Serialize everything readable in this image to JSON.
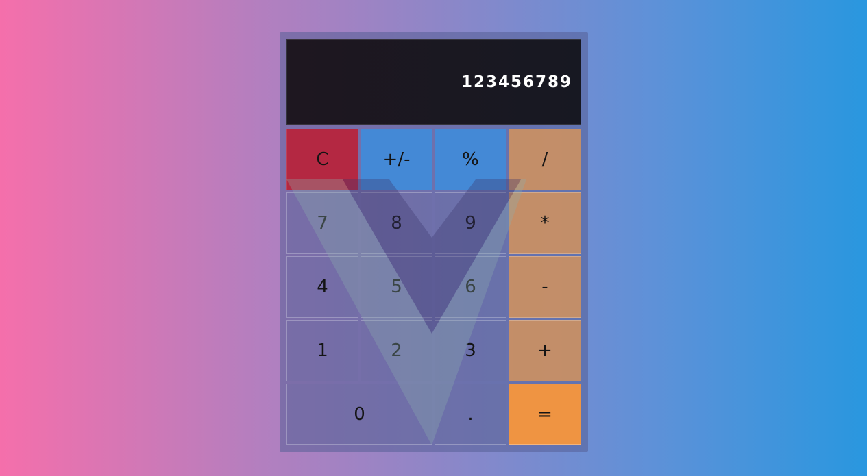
{
  "display": {
    "value": "123456789"
  },
  "keys": {
    "clear": "C",
    "negate": "+/-",
    "percent": "%",
    "divide": "/",
    "seven": "7",
    "eight": "8",
    "nine": "9",
    "multiply": "*",
    "four": "4",
    "five": "5",
    "six": "6",
    "subtract": "-",
    "one": "1",
    "two": "2",
    "three": "3",
    "add": "+",
    "zero": "0",
    "decimal": ".",
    "equals": "="
  },
  "colors": {
    "clear": "#b42842",
    "function": "#4489d6",
    "operator": "#de9655",
    "equals": "#ef9442",
    "display": "#1b1720"
  },
  "background_icon": "vue-logo-icon"
}
